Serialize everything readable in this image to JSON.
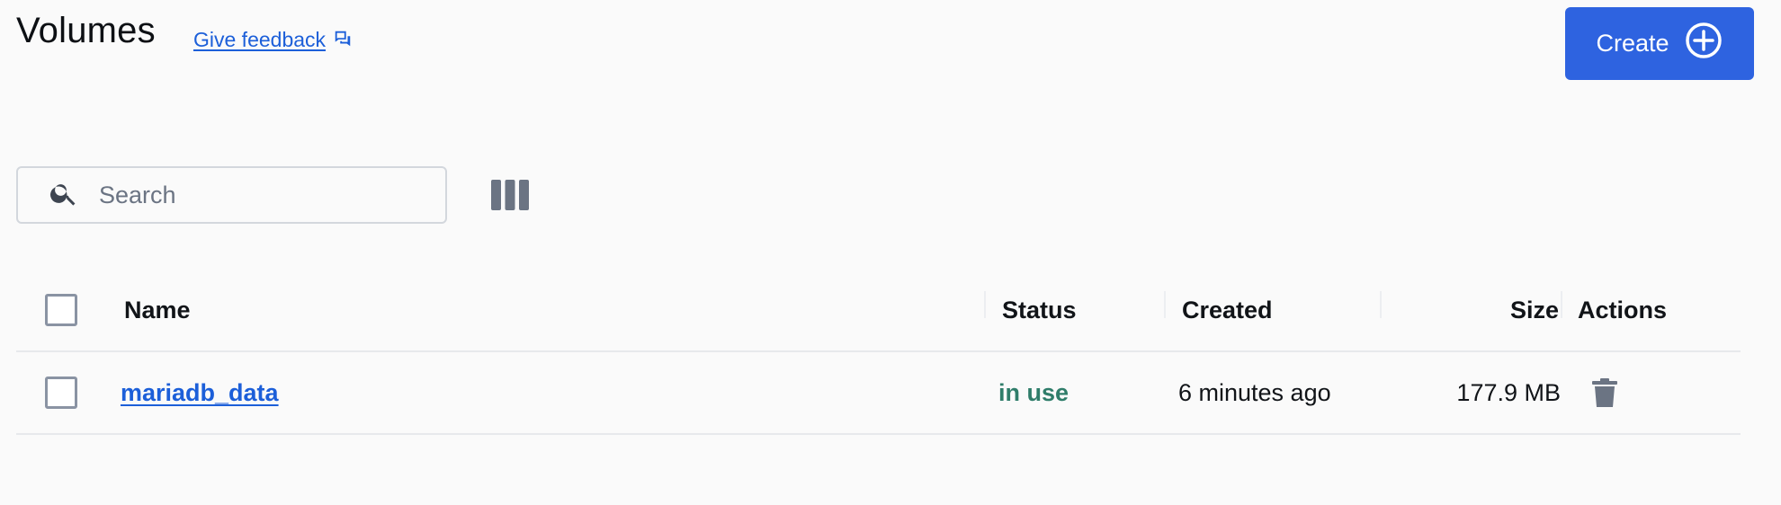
{
  "header": {
    "title": "Volumes",
    "feedback_label": "Give feedback",
    "create_label": "Create"
  },
  "colors": {
    "accent": "#2e63e0",
    "link": "#1c5fd9",
    "status_in_use": "#2f7d6a",
    "icon_gray": "#6b7483"
  },
  "toolbar": {
    "search_placeholder": "Search",
    "search_value": ""
  },
  "icons": {
    "feedback": "feedback-chat-icon",
    "create": "plus-circle-icon",
    "search": "search-icon",
    "columns": "columns-icon",
    "delete": "trash-icon"
  },
  "table": {
    "columns": [
      "Name",
      "Status",
      "Created",
      "Size",
      "Actions"
    ],
    "rows": [
      {
        "name": "mariadb_data",
        "status": "in use",
        "created": "6 minutes ago",
        "size": "177.9 MB"
      }
    ]
  }
}
